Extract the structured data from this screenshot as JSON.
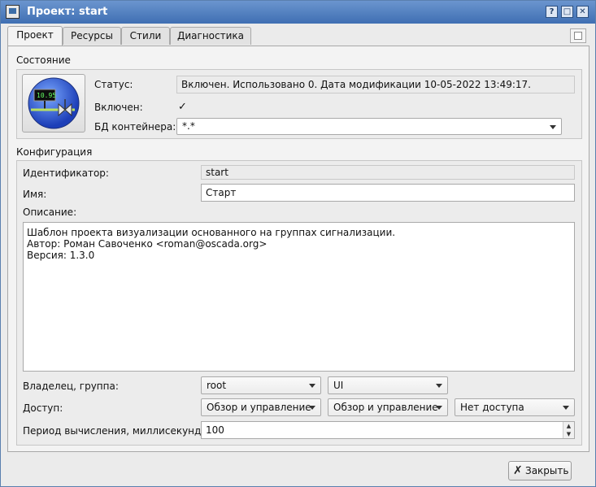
{
  "window": {
    "title": "Проект: start"
  },
  "tabs": [
    {
      "label": "Проект"
    },
    {
      "label": "Ресурсы"
    },
    {
      "label": "Стили"
    },
    {
      "label": "Диагностика"
    }
  ],
  "state": {
    "section_label": "Состояние",
    "status_label": "Статус:",
    "status_value": "Включен. Использовано 0. Дата модификации 10-05-2022 13:49:17.",
    "enabled_label": "Включен:",
    "enabled_checked": true,
    "db_label": "БД контейнера:",
    "db_value": "*.*",
    "icon_text": "10.95"
  },
  "config": {
    "section_label": "Конфигурация",
    "id_label": "Идентификатор:",
    "id_value": "start",
    "name_label": "Имя:",
    "name_value": "Старт",
    "descr_label": "Описание:",
    "descr_lines": [
      "Шаблон проекта визуализации основанного на группах сигнализации.",
      "Автор: Роман Савоченко <roman@oscada.org>",
      "Версия: 1.3.0"
    ],
    "owner_label": "Владелец, группа:",
    "owner_value": "root",
    "group_value": "UI",
    "access_label": "Доступ:",
    "access_owner": "Обзор и управление",
    "access_group": "Обзор и управление",
    "access_other": "Нет доступа",
    "period_label": "Период вычисления, миллисекунд:",
    "period_value": "100"
  },
  "footer": {
    "close_label": "Закрыть"
  },
  "colors": {
    "titlebar": "#4a7bc0",
    "accent": "#3d6ea8"
  }
}
